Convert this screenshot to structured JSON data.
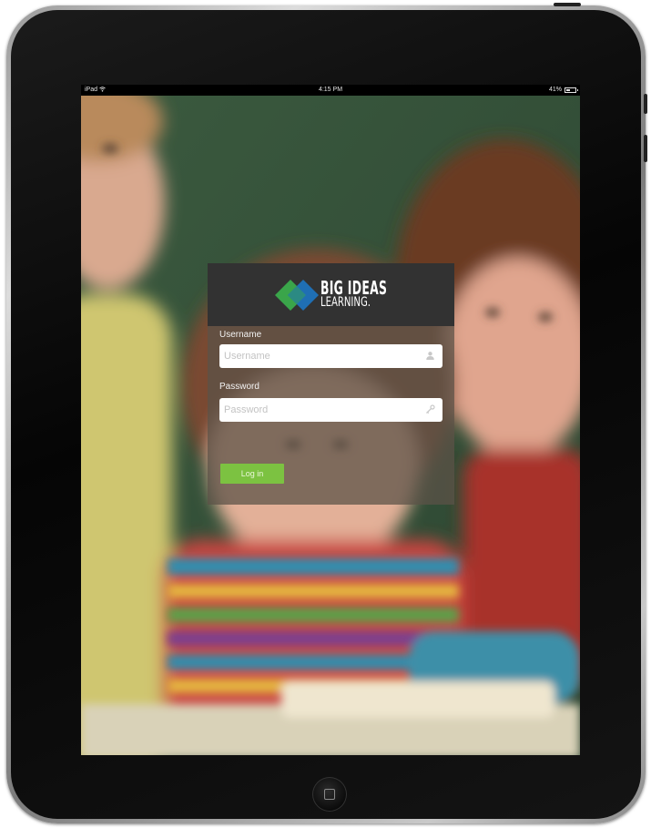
{
  "device": {
    "name": "iPad",
    "frame_color": "#0b0b0b",
    "bezel_color": "#a8a8a8"
  },
  "status_bar": {
    "carrier": "iPad",
    "wifi_icon": "wifi-icon",
    "time": "4:15 PM",
    "battery_text": "41%",
    "battery_icon": "battery-icon",
    "battery_level": 0.41
  },
  "background": {
    "description_icon": "blurred-classroom-photo",
    "colors": {
      "chalkboard": "#36503a",
      "yellow_shirt": "#d8d27a",
      "red_shirt": "#a8342e",
      "striped_shirt": [
        "#2f8fb0",
        "#c33a4a",
        "#e5b640",
        "#5aa24a"
      ]
    }
  },
  "login": {
    "logo": {
      "line1": "BIG IDEAS",
      "line2": "LEARNING.",
      "colors": [
        "#3aa54a",
        "#1f6fb4"
      ]
    },
    "username": {
      "label": "Username",
      "placeholder": "Username",
      "value": "",
      "icon": "user-icon"
    },
    "password": {
      "label": "Password",
      "placeholder": "Password",
      "value": "",
      "icon": "key-icon"
    },
    "submit_label": "Log in",
    "accent": "#7cc241",
    "card_header_color": "#323232"
  },
  "home_button": {
    "icon": "home-square-icon"
  }
}
